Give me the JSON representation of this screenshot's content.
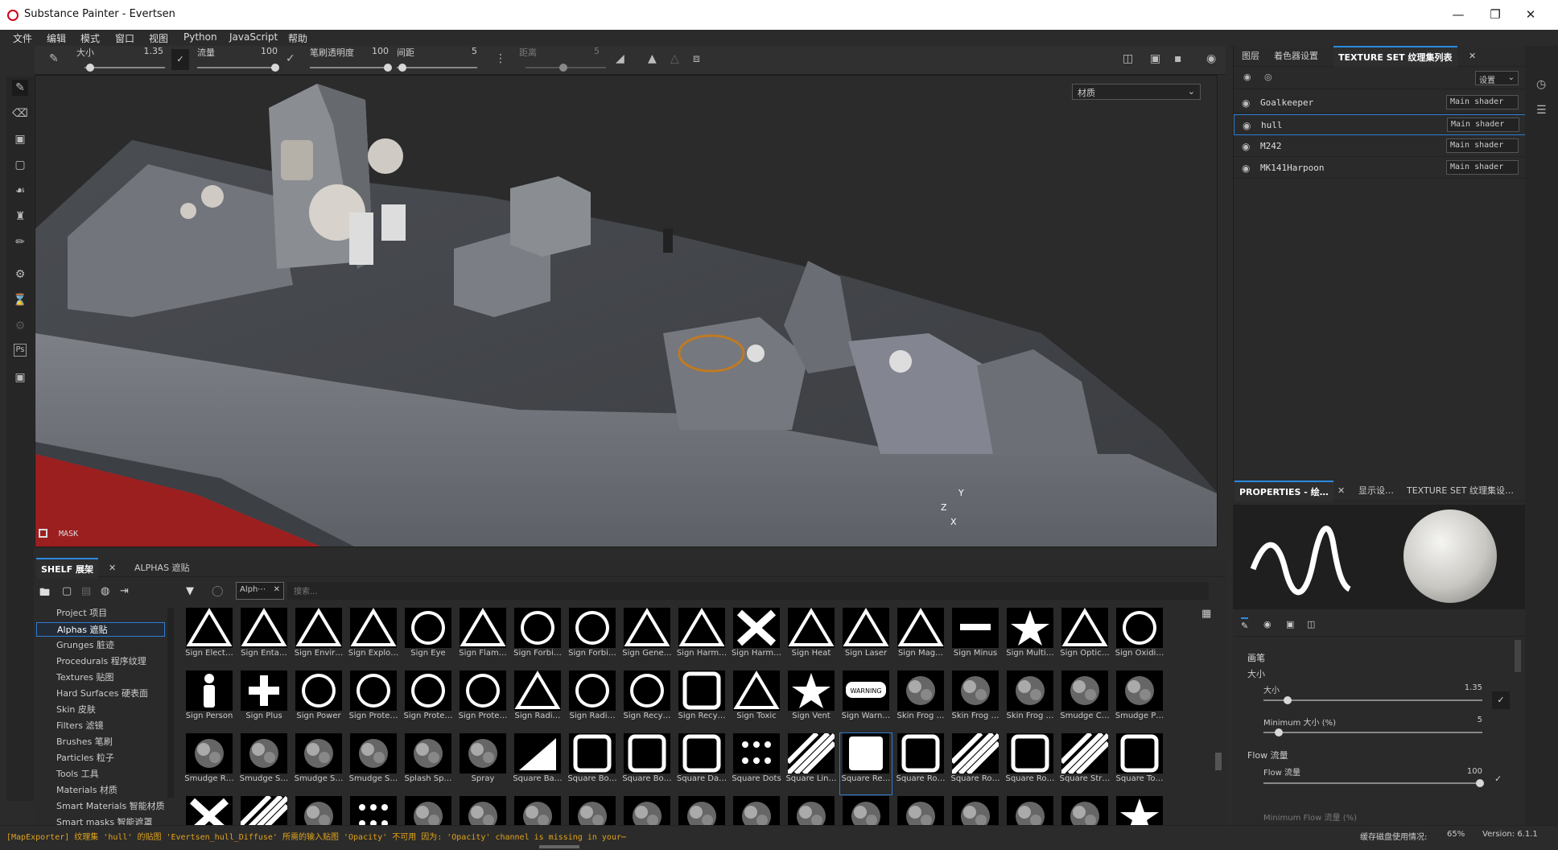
{
  "app": {
    "title": "Substance Painter - Evertsen"
  },
  "menu": [
    "文件",
    "编辑",
    "模式",
    "窗口",
    "视图",
    "Python",
    "JavaScript",
    "帮助"
  ],
  "tool_options": {
    "size_label": "大小",
    "size_value": "1.35",
    "flow_label": "流量",
    "flow_value": "100",
    "opacity_label": "笔刷透明度",
    "opacity_value": "100",
    "spacing_label": "间距",
    "spacing_value": "5",
    "jitter_label": "距离",
    "jitter_value": "5"
  },
  "viewport": {
    "material_select": "材质",
    "mask_label": "MASK",
    "axis_y": "Y",
    "axis_z": "Z",
    "axis_x": "X"
  },
  "texture_sets": {
    "tabs": [
      "图层",
      "着色器设置",
      "TEXTURE SET 纹理集列表"
    ],
    "settings_label": "设置",
    "rows": [
      {
        "name": "Goalkeeper",
        "shader": "Main shader"
      },
      {
        "name": "hull",
        "shader": "Main shader"
      },
      {
        "name": "M242",
        "shader": "Main shader"
      },
      {
        "name": "MK141Harpoon",
        "shader": "Main shader"
      }
    ]
  },
  "properties": {
    "tabs": [
      "PROPERTIES - 绘…",
      "显示设…",
      "TEXTURE SET 纹理集设…"
    ],
    "section_brush": "画笔",
    "size_group": "大小",
    "size_label": "大小",
    "size_value": "1.35",
    "min_size_label": "Minimum 大小 (%)",
    "min_size_value": "5",
    "flow_group": "Flow 流量",
    "flow_label": "Flow 流量",
    "flow_value": "100",
    "min_flow_label": "Minimum Flow 流量 (%)"
  },
  "shelf": {
    "tabs": [
      "SHELF 展架",
      "ALPHAS 遮贴"
    ],
    "filter_chip": "Alph⋯",
    "search_placeholder": "搜索...",
    "categories": [
      "Project 项目",
      "Alphas 遮贴",
      "Grunges 脏迹",
      "Procedurals 程序纹理",
      "Textures 贴图",
      "Hard Surfaces 硬表面",
      "Skin 皮肤",
      "Filters 滤镜",
      "Brushes 笔刷",
      "Particles 粒子",
      "Tools 工具",
      "Materials 材质",
      "Smart Materials 智能材质",
      "Smart masks 智能遮罩"
    ],
    "row1": [
      "Sign Elect…",
      "Sign Enta…",
      "Sign Envir…",
      "Sign Explo…",
      "Sign Eye",
      "Sign Flam…",
      "Sign Forbi…",
      "Sign Forbi…",
      "Sign Gene…",
      "Sign Harm…",
      "Sign Harm…",
      "Sign Heat",
      "Sign Laser",
      "Sign Mag…",
      "Sign Minus",
      "Sign Multi…",
      "Sign Optic…",
      "Sign Oxidi…"
    ],
    "row2": [
      "Sign Person",
      "Sign Plus",
      "Sign Power",
      "Sign Prote…",
      "Sign Prote…",
      "Sign Prote…",
      "Sign Radi…",
      "Sign Radi…",
      "Sign Recy…",
      "Sign Recy…",
      "Sign Toxic",
      "Sign Vent",
      "Sign Warn…",
      "Skin Frog …",
      "Skin Frog …",
      "Skin Frog …",
      "Smudge C…",
      "Smudge P…"
    ],
    "row3": [
      "Smudge R…",
      "Smudge S…",
      "Smudge S…",
      "Smudge S…",
      "Splash Sp…",
      "Spray",
      "Square Ba…",
      "Square Bo…",
      "Square Bo…",
      "Square Da…",
      "Square Dots",
      "Square Lin…",
      "Square Re…",
      "Square Ro…",
      "Square Ro…",
      "Square Ro…",
      "Square Str…",
      "Square To…"
    ],
    "warning_badge": "WARNING"
  },
  "status": {
    "message": "[MapExporter] 纹理集 'hull' 的贴图 'Evertsen_hull_Diffuse' 所需的输入贴图 'Opacity' 不可用 因为: 'Opacity' channel is missing in your⋯",
    "cache_label": "缓存磁盘使用情况:",
    "cache_value": "65%",
    "version": "Version: 6.1.1"
  },
  "colors": {
    "accent": "#2f7cd1",
    "warning_text": "#e0a21a",
    "hull_red": "#9c1f1f"
  }
}
